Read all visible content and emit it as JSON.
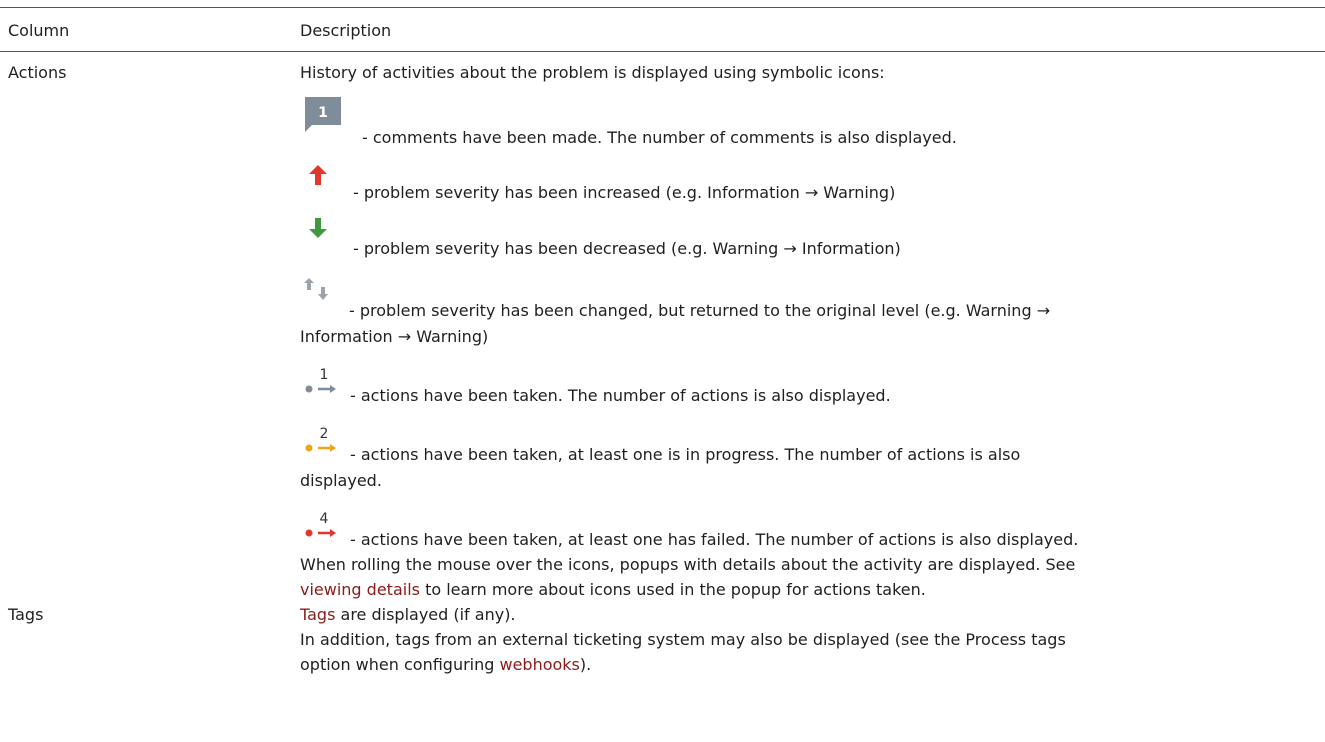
{
  "table": {
    "headers": [
      "Column",
      "Description"
    ],
    "rows": [
      {
        "column": "Actions",
        "intro": "History of activities about the problem is displayed using symbolic icons:",
        "icons": [
          {
            "icon": "comment-count-icon",
            "badge": "1",
            "color": "#7f8c99",
            "text": "- comments have been made. The number of comments is also displayed."
          },
          {
            "icon": "arrow-up-icon",
            "color": "#e0392b",
            "text": "- problem severity has been increased (e.g. Information → Warning)"
          },
          {
            "icon": "arrow-down-icon",
            "color": "#3f9a3f",
            "text": "- problem severity has been decreased (e.g. Warning → Information)"
          },
          {
            "icon": "arrows-up-down-icon",
            "color": "#9aa4ad",
            "text": "- problem severity has been changed, but returned to the original level (e.g. Warning →",
            "text_cont": "Information → Warning)"
          },
          {
            "icon": "action-gray-icon",
            "badge": "1",
            "color": "#7f8c99",
            "text": "- actions have been taken. The number of actions is also displayed."
          },
          {
            "icon": "action-orange-icon",
            "badge": "2",
            "color": "#f3a21b",
            "text": "- actions have been taken, at least one is in progress. The number of actions is also",
            "text_cont": "displayed."
          },
          {
            "icon": "action-red-icon",
            "badge": "4",
            "color": "#e0392b",
            "text": "- actions have been taken, at least one has failed. The number of actions is also displayed."
          }
        ],
        "note_line1": "When rolling the mouse over the icons, popups with details about the activity are displayed. See",
        "note_link": "viewing details",
        "note_line2_rest": " to learn more about icons used in the popup for actions taken."
      },
      {
        "column": "Tags",
        "link1": "Tags",
        "line1_rest": " are displayed (if any).",
        "line2": "In addition, tags from an external ticketing system may also be displayed (see the Process tags",
        "line3_pre": "option when configuring ",
        "link2": "webhooks",
        "line3_post": ")."
      }
    ]
  }
}
